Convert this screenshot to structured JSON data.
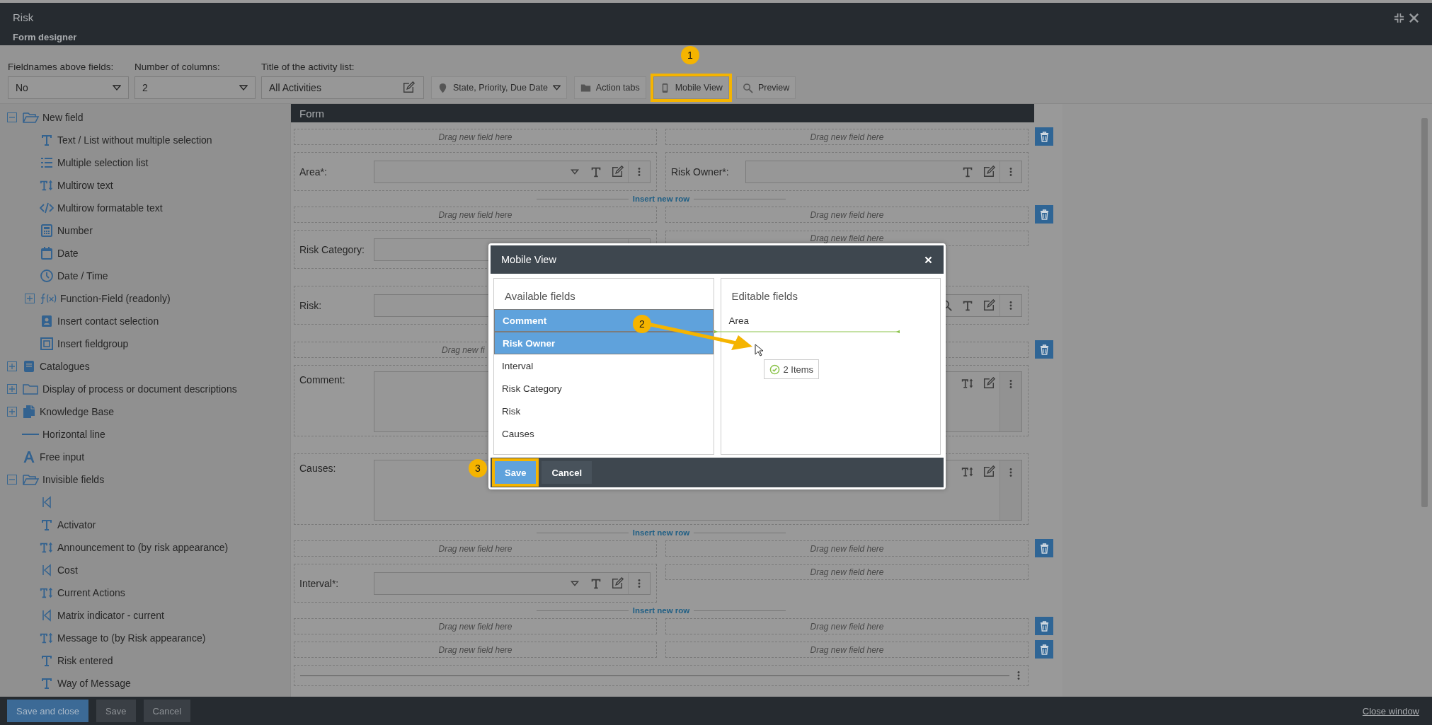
{
  "window": {
    "title": "Risk",
    "subtitle": "Form designer"
  },
  "toolbar": {
    "fieldnames_above_fields": {
      "label": "Fieldnames above fields:",
      "value": "No"
    },
    "number_of_columns": {
      "label": "Number of columns:",
      "value": "2"
    },
    "activity_list_title": {
      "label": "Title of the activity list:",
      "value": "All Activities"
    },
    "buttons": [
      {
        "kind": "sort",
        "label": "State, Priority, Due Date",
        "highlighted": false
      },
      {
        "kind": "tabs",
        "label": "Action tabs",
        "highlighted": false
      },
      {
        "kind": "mobile",
        "label": "Mobile View",
        "highlighted": true
      },
      {
        "kind": "preview",
        "label": "Preview",
        "highlighted": false
      }
    ]
  },
  "sidebar": {
    "items": [
      {
        "kind": "folder",
        "label": "New field",
        "expanded": true,
        "children": [
          {
            "kind": "text",
            "label": "Text / List without multiple selection"
          },
          {
            "kind": "list",
            "label": "Multiple selection list"
          },
          {
            "kind": "multirow",
            "label": "Multirow text"
          },
          {
            "kind": "html",
            "label": "Multirow formatable text"
          },
          {
            "kind": "number",
            "label": "Number"
          },
          {
            "kind": "date",
            "label": "Date"
          },
          {
            "kind": "datetime",
            "label": "Date / Time"
          },
          {
            "kind": "function",
            "label": "Function-Field (readonly)",
            "expanded": false
          },
          {
            "kind": "contact",
            "label": "Insert contact selection"
          },
          {
            "kind": "fieldgroup",
            "label": "Insert fieldgroup"
          }
        ]
      },
      {
        "kind": "catalogue",
        "label": "Catalogues",
        "expanded": false
      },
      {
        "kind": "folder",
        "label": "Display of process or document descriptions",
        "expanded": false
      },
      {
        "kind": "knowledge",
        "label": "Knowledge Base",
        "expanded": false
      },
      {
        "kind": "line",
        "label": "Horizontal line"
      },
      {
        "kind": "free",
        "label": "Free input"
      },
      {
        "kind": "folder",
        "label": "Invisible fields",
        "expanded": true,
        "children": [
          {
            "kind": "link"
          },
          {
            "kind": "text",
            "label": "Activator"
          },
          {
            "kind": "multirow",
            "label": "Announcement to (by risk appearance)"
          },
          {
            "kind": "link",
            "label": "Cost"
          },
          {
            "kind": "multirow",
            "label": "Current Actions"
          },
          {
            "kind": "link",
            "label": "Matrix indicator - current"
          },
          {
            "kind": "multirow",
            "label": "Message to (by Risk appearance)"
          },
          {
            "kind": "text",
            "label": "Risk entered"
          },
          {
            "kind": "text",
            "label": "Way of Message"
          }
        ]
      }
    ]
  },
  "form": {
    "title": "Form",
    "rows": [
      {
        "kind": "drop",
        "deletable": true,
        "cells": [
          {
            "kind": "drop",
            "text": "Drag new field here"
          },
          {
            "kind": "drop",
            "text": "Drag new field here"
          }
        ]
      },
      {
        "kind": "fields",
        "deletable": false,
        "cells": [
          {
            "kind": "select",
            "label": "Area*:"
          },
          {
            "kind": "text",
            "label": "Risk Owner*:"
          }
        ]
      },
      {
        "kind": "insert",
        "deletable": false,
        "text": "Insert new row"
      },
      {
        "kind": "drop",
        "deletable": true,
        "cells": [
          {
            "kind": "drop",
            "text": "Drag new field here"
          },
          {
            "kind": "drop",
            "text": "Drag new field here"
          }
        ]
      },
      {
        "kind": "fields",
        "deletable": false,
        "cells": [
          {
            "kind": "plain",
            "label": "Risk Category:"
          },
          {
            "kind": "drop",
            "text": "Drag new field here"
          }
        ]
      },
      {
        "kind": "fields",
        "deletable": false,
        "cells": [
          {
            "kind": "lookup",
            "label": "Risk:"
          }
        ]
      },
      {
        "kind": "drop",
        "deletable": true,
        "cells": [
          {
            "kind": "drop",
            "text": "Drag new fi",
            "cut": true
          },
          {
            "kind": "drop"
          }
        ]
      },
      {
        "kind": "fields",
        "deletable": false,
        "cells": [
          {
            "kind": "textarea",
            "label": "Comment:"
          }
        ]
      },
      {
        "kind": "fields",
        "deletable": false,
        "cells": [
          {
            "kind": "textarea",
            "label": "Causes:"
          }
        ]
      },
      {
        "kind": "insert",
        "deletable": false,
        "text": "Insert new row"
      },
      {
        "kind": "drop",
        "deletable": true,
        "cells": [
          {
            "kind": "drop",
            "text": "Drag new field here"
          },
          {
            "kind": "drop",
            "text": "Drag new field here"
          }
        ]
      },
      {
        "kind": "fields",
        "deletable": false,
        "cells": [
          {
            "kind": "select",
            "label": "Interval*:"
          },
          {
            "kind": "drop",
            "text": "Drag new field here"
          }
        ]
      },
      {
        "kind": "insert",
        "deletable": false,
        "text": "Insert new row"
      },
      {
        "kind": "drop",
        "deletable": true,
        "cells": [
          {
            "kind": "drop",
            "text": "Drag new field here"
          },
          {
            "kind": "drop",
            "text": "Drag new field here"
          }
        ]
      },
      {
        "kind": "drop",
        "deletable": true,
        "cells": [
          {
            "kind": "drop",
            "text": "Drag new field here"
          },
          {
            "kind": "drop",
            "text": "Drag new field here"
          }
        ]
      },
      {
        "kind": "fields",
        "deletable": false,
        "cells": [
          {
            "kind": "line"
          }
        ]
      }
    ]
  },
  "mobile_view": {
    "title": "Mobile View",
    "available_fields": {
      "title": "Available fields",
      "items": [
        {
          "label": "Comment",
          "selected": true
        },
        {
          "label": "Risk Owner",
          "selected": true
        },
        {
          "label": "Interval",
          "selected": false
        },
        {
          "label": "Risk Category",
          "selected": false
        },
        {
          "label": "Risk",
          "selected": false
        },
        {
          "label": "Causes",
          "selected": false
        }
      ]
    },
    "editable_fields": {
      "title": "Editable fields",
      "items": [
        "Area"
      ],
      "drag_badge": "2 Items"
    },
    "buttons": [
      {
        "kind": "primary",
        "label": "Save",
        "highlighted": true
      },
      {
        "kind": "secondary",
        "label": "Cancel",
        "highlighted": false
      }
    ]
  },
  "annotations": [
    {
      "number": "1"
    },
    {
      "number": "2"
    },
    {
      "number": "3"
    }
  ],
  "footer": {
    "buttons": [
      {
        "kind": "primary",
        "label": "Save and close"
      },
      {
        "kind": "secondary",
        "label": "Save"
      },
      {
        "kind": "secondary",
        "label": "Cancel"
      }
    ],
    "link": "Close window"
  }
}
